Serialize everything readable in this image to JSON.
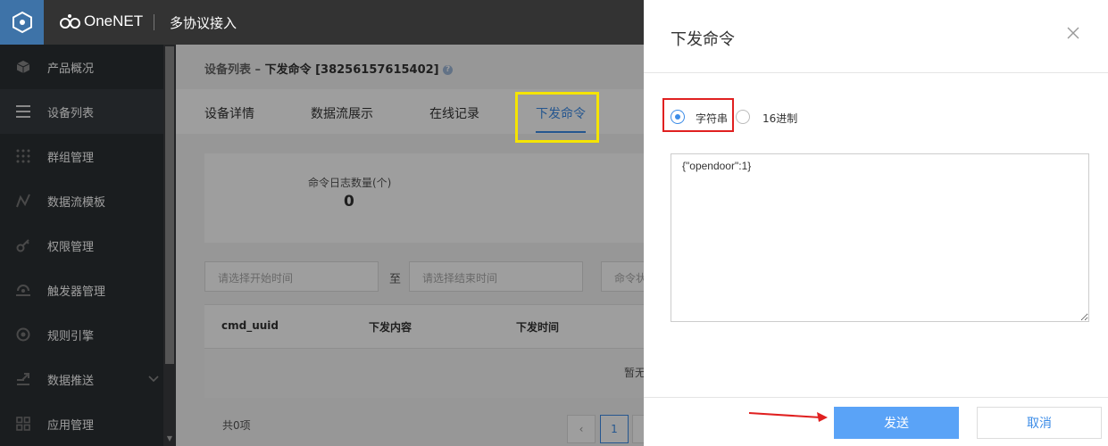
{
  "colors": {
    "accent": "#3c8ce7",
    "topbar": "#333333",
    "sidebar": "#2b2f33",
    "logo_box": "#3e73a8",
    "send_button": "#5aa3f7",
    "highlight_yellow": "#f5e400",
    "highlight_red": "#e02020"
  },
  "header": {
    "brand": "OneNET",
    "app_title": "多协议接入"
  },
  "sidebar": {
    "items": [
      {
        "label": "产品概况",
        "icon": "cube-icon"
      },
      {
        "label": "设备列表",
        "icon": "list-icon",
        "active": true
      },
      {
        "label": "群组管理",
        "icon": "grid-dots-icon"
      },
      {
        "label": "数据流模板",
        "icon": "datastream-icon"
      },
      {
        "label": "权限管理",
        "icon": "key-icon"
      },
      {
        "label": "触发器管理",
        "icon": "trigger-icon"
      },
      {
        "label": "规则引擎",
        "icon": "rule-engine-icon"
      },
      {
        "label": "数据推送",
        "icon": "push-icon",
        "expandable": true
      },
      {
        "label": "应用管理",
        "icon": "apps-icon"
      }
    ]
  },
  "breadcrumb": {
    "parent": "设备列表",
    "separator": " – ",
    "current": "下发命令 [38256157615402]"
  },
  "tabs": [
    {
      "label": "设备详情"
    },
    {
      "label": "数据流展示"
    },
    {
      "label": "在线记录"
    },
    {
      "label": "下发命令",
      "active": true
    }
  ],
  "stats": {
    "label": "命令日志数量(个)",
    "value": "0"
  },
  "filters": {
    "start_placeholder": "请选择开始时间",
    "to_label": "至",
    "end_placeholder": "请选择结束时间",
    "third_placeholder": "命令状"
  },
  "table": {
    "columns": [
      "cmd_uuid",
      "下发内容",
      "下发时间"
    ],
    "empty_text": "暂无"
  },
  "pagination": {
    "total": "共0项",
    "prev": "‹",
    "current_page": "1"
  },
  "drawer": {
    "title": "下发命令",
    "format_options": [
      {
        "label": "字符串",
        "checked": true
      },
      {
        "label": "16进制",
        "checked": false
      }
    ],
    "payload": "{\"opendoor\":1}",
    "send_label": "发送",
    "cancel_label": "取消"
  }
}
